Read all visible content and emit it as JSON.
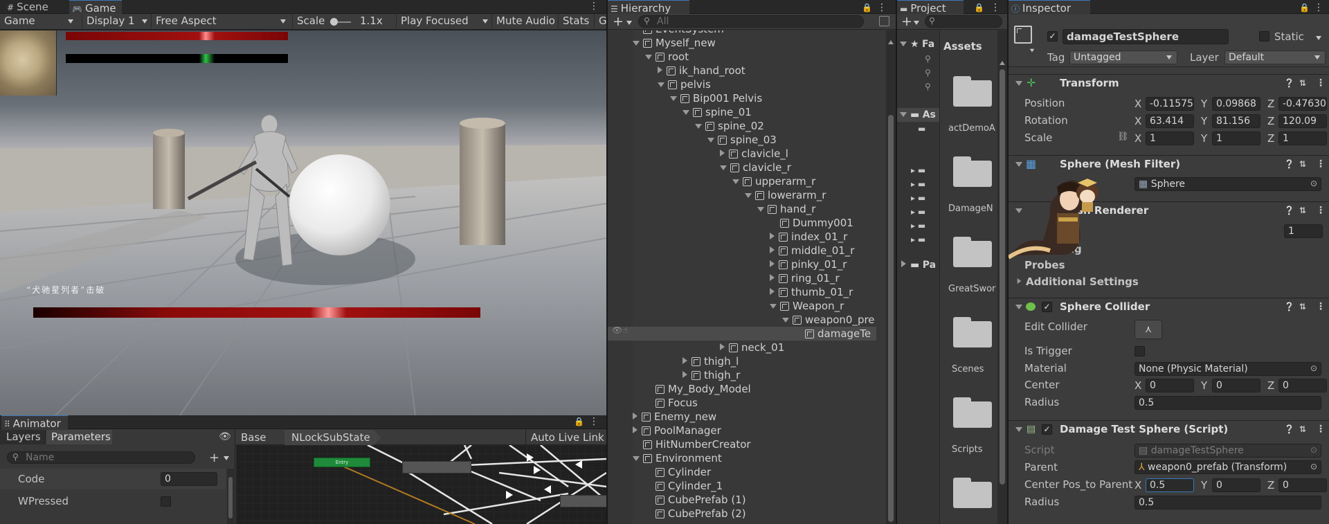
{
  "game_pane": {
    "tab_scene": "Scene",
    "tab_game": "Game",
    "game_mode": "Game",
    "display": "Display 1",
    "aspect": "Free Aspect",
    "scale_label": "Scale",
    "scale_value": "1.1x",
    "play_focused": "Play Focused",
    "mute_audio": "Mute Audio",
    "stats": "Stats",
    "gizmos": "Gi",
    "overlay_text": "“犬驰星列者”击破"
  },
  "animator": {
    "tab": "Animator",
    "layers": "Layers",
    "parameters": "Parameters",
    "name_placeholder": "Name",
    "base": "Base",
    "breadcrumb": "NLockSubState",
    "auto_live_link": "Auto Live Link",
    "params": [
      {
        "name": "Code",
        "value": "0"
      },
      {
        "name": "WPressed",
        "value": ""
      }
    ],
    "entry_label": "Entry"
  },
  "hierarchy": {
    "tab": "Hierarchy",
    "search_placeholder": "All",
    "rows": [
      {
        "label": "EventSystem",
        "depth": 1,
        "fold": "none"
      },
      {
        "label": "Myself_new",
        "depth": 1,
        "fold": "open"
      },
      {
        "label": "root",
        "depth": 2,
        "fold": "open"
      },
      {
        "label": "ik_hand_root",
        "depth": 3,
        "fold": "closed"
      },
      {
        "label": "pelvis",
        "depth": 3,
        "fold": "open"
      },
      {
        "label": "Bip001 Pelvis",
        "depth": 4,
        "fold": "open"
      },
      {
        "label": "spine_01",
        "depth": 5,
        "fold": "open"
      },
      {
        "label": "spine_02",
        "depth": 6,
        "fold": "open"
      },
      {
        "label": "spine_03",
        "depth": 7,
        "fold": "open"
      },
      {
        "label": "clavicle_l",
        "depth": 8,
        "fold": "closed"
      },
      {
        "label": "clavicle_r",
        "depth": 8,
        "fold": "open"
      },
      {
        "label": "upperarm_r",
        "depth": 9,
        "fold": "open"
      },
      {
        "label": "lowerarm_r",
        "depth": 10,
        "fold": "open"
      },
      {
        "label": "hand_r",
        "depth": 11,
        "fold": "open"
      },
      {
        "label": "Dummy001",
        "depth": 12,
        "fold": "none"
      },
      {
        "label": "index_01_r",
        "depth": 12,
        "fold": "closed"
      },
      {
        "label": "middle_01_r",
        "depth": 12,
        "fold": "closed"
      },
      {
        "label": "pinky_01_r",
        "depth": 12,
        "fold": "closed"
      },
      {
        "label": "ring_01_r",
        "depth": 12,
        "fold": "closed"
      },
      {
        "label": "thumb_01_r",
        "depth": 12,
        "fold": "closed"
      },
      {
        "label": "Weapon_r",
        "depth": 12,
        "fold": "open"
      },
      {
        "label": "weapon0_pre",
        "depth": 13,
        "fold": "open"
      },
      {
        "label": "damageTe",
        "depth": 14,
        "fold": "none"
      },
      {
        "label": "neck_01",
        "depth": 8,
        "fold": "closed"
      },
      {
        "label": "thigh_l",
        "depth": 5,
        "fold": "closed"
      },
      {
        "label": "thigh_r",
        "depth": 5,
        "fold": "closed"
      },
      {
        "label": "My_Body_Model",
        "depth": 2,
        "fold": "none"
      },
      {
        "label": "Focus",
        "depth": 2,
        "fold": "none"
      },
      {
        "label": "Enemy_new",
        "depth": 1,
        "fold": "closed"
      },
      {
        "label": "PoolManager",
        "depth": 1,
        "fold": "closed"
      },
      {
        "label": "HitNumberCreator",
        "depth": 1,
        "fold": "none"
      },
      {
        "label": "Environment",
        "depth": 1,
        "fold": "open"
      },
      {
        "label": "Cylinder",
        "depth": 2,
        "fold": "none"
      },
      {
        "label": "Cylinder_1",
        "depth": 2,
        "fold": "none"
      },
      {
        "label": "CubePrefab (1)",
        "depth": 2,
        "fold": "none"
      },
      {
        "label": "CubePrefab (2)",
        "depth": 2,
        "fold": "none"
      }
    ]
  },
  "project": {
    "tab": "Project",
    "assets_label": "Assets",
    "favorites": "Fa",
    "assets_short": "As",
    "packages": "Pa",
    "folders": [
      "actDemoA",
      "DamageN",
      "GreatSwor",
      "Scenes",
      "Scripts",
      ""
    ]
  },
  "inspector": {
    "tab": "Inspector",
    "object_name": "damageTestSphere",
    "static": "Static",
    "tag_label": "Tag",
    "tag_value": "Untagged",
    "layer_label": "Layer",
    "layer_value": "Default",
    "transform": {
      "title": "Transform",
      "position_label": "Position",
      "rotation_label": "Rotation",
      "scale_label": "Scale",
      "position": [
        "-0.11575",
        "0.09868",
        "-0.47630"
      ],
      "rotation": [
        "63.414",
        "81.156",
        "120.09"
      ],
      "scale": [
        "1",
        "1",
        "1"
      ]
    },
    "mesh_filter": {
      "title": "Sphere (Mesh Filter)",
      "mesh": "Sphere"
    },
    "mesh_renderer": {
      "title": "Mesh Renderer",
      "value": "1",
      "lighting": "ting",
      "probes": "Probes",
      "additional": "Additional Settings"
    },
    "collider": {
      "title": "Sphere Collider",
      "edit_collider": "Edit Collider",
      "is_trigger": "Is Trigger",
      "material_label": "Material",
      "material": "None (Physic Material)",
      "center_label": "Center",
      "center": [
        "0",
        "0",
        "0"
      ],
      "radius_label": "Radius",
      "radius": "0.5"
    },
    "script": {
      "title": "Damage Test Sphere (Script)",
      "script_label": "Script",
      "script_value": "damageTestSphere",
      "parent_label": "Parent",
      "parent_value": "weapon0_prefab (Transform)",
      "center_label": "Center Pos_to Parent",
      "center": [
        "0.5",
        "0",
        "0"
      ],
      "radius_label": "Radius",
      "radius": "0.5"
    }
  },
  "colors": {
    "accent": "#3a79bb",
    "panel": "#383838",
    "selection": "#2c5d87"
  }
}
